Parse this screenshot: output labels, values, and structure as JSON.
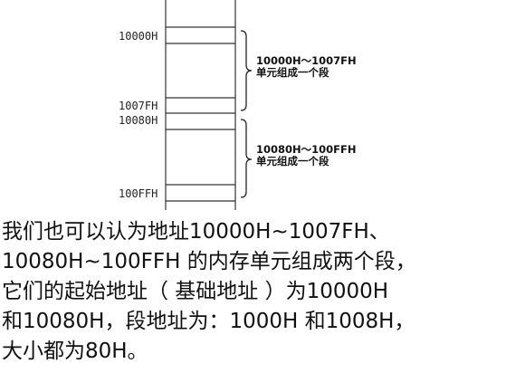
{
  "diagram": {
    "addresses": {
      "a10000": "10000H",
      "a1007F": "1007FH",
      "a10080": "10080H",
      "a100FF": "100FFH"
    },
    "segment1": {
      "range": "10000H～1007FH",
      "desc": "单元组成一个段"
    },
    "segment2": {
      "range": "10080H～100FFH",
      "desc": "单元组成一个段"
    }
  },
  "text": {
    "line1": "我们也可以认为地址10000H~1007FH、",
    "line2": "10080H~100FFH 的内存单元组成两个段，",
    "line3": "它们的起始地址（ 基础地址 ）为10000H",
    "line4": "和10080H，段地址为：1000H  和1008H，",
    "line5": "大小都为80H。"
  }
}
